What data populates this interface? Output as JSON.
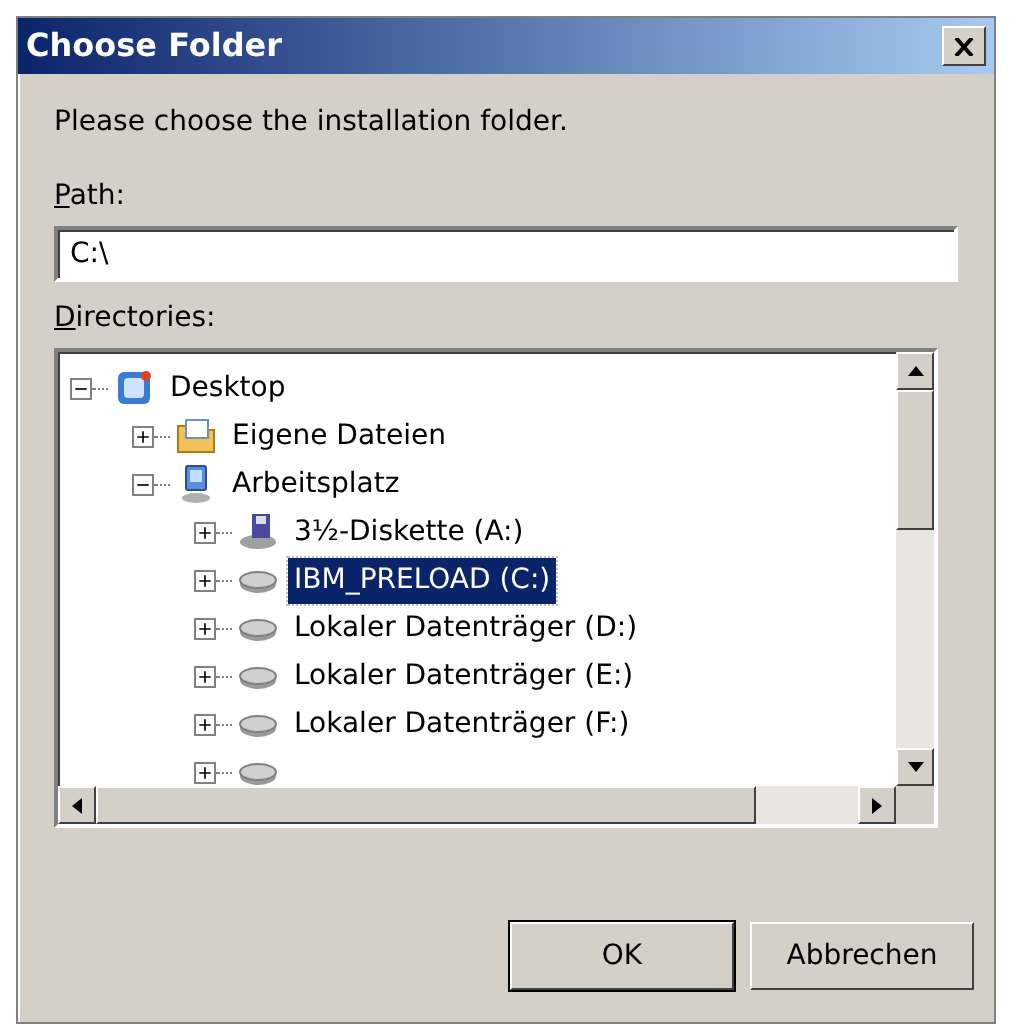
{
  "window": {
    "title": "Choose Folder"
  },
  "prompt": "Please choose the installation folder.",
  "path": {
    "label": "Path:",
    "first_letter_underlined": true,
    "value": "C:\\"
  },
  "directories": {
    "label": "Directories:",
    "first_letter_underlined": true,
    "tree": [
      {
        "label": "Desktop",
        "kind": "desktop",
        "expanded": true,
        "selected": false,
        "children": [
          {
            "label": "Eigene Dateien",
            "kind": "documents",
            "expanded": false,
            "selected": false
          },
          {
            "label": "Arbeitsplatz",
            "kind": "computer",
            "expanded": true,
            "selected": false,
            "children": [
              {
                "label": "3½-Diskette (A:)",
                "kind": "floppy",
                "expanded": false,
                "selected": false
              },
              {
                "label": "IBM_PRELOAD (C:)",
                "kind": "drive",
                "expanded": false,
                "selected": true
              },
              {
                "label": "Lokaler Datenträger (D:)",
                "kind": "drive",
                "expanded": false,
                "selected": false
              },
              {
                "label": "Lokaler Datenträger (E:)",
                "kind": "drive",
                "expanded": false,
                "selected": false
              },
              {
                "label": "Lokaler Datenträger (F:)",
                "kind": "drive",
                "expanded": false,
                "selected": false
              },
              {
                "kind": "drive",
                "expanded": false
              }
            ]
          }
        ]
      }
    ]
  },
  "buttons": [
    {
      "label": "OK",
      "default": true
    },
    {
      "label": "Abbrechen",
      "default": false
    }
  ]
}
